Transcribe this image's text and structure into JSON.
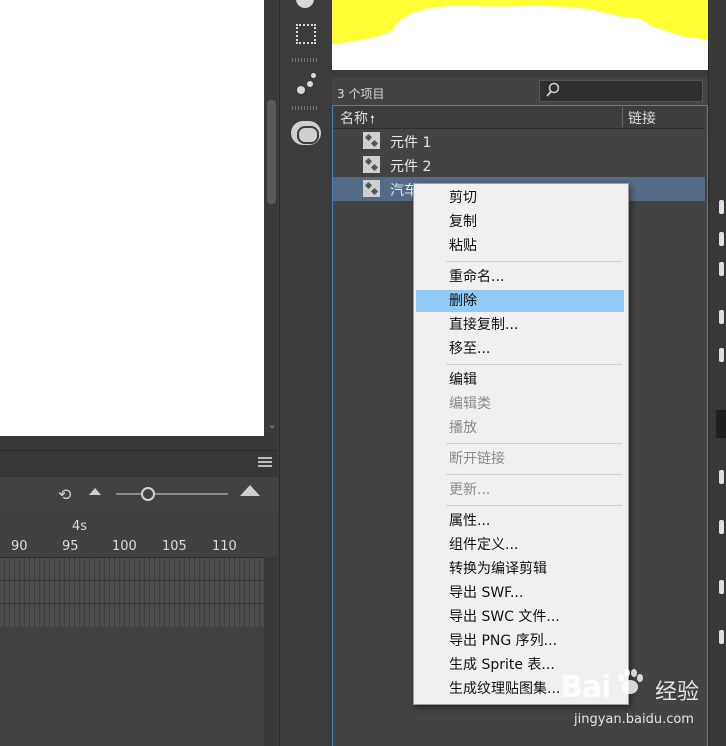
{
  "library": {
    "item_count": "3 个项目",
    "columns": {
      "name": "名称",
      "sort_arrow": "🠕",
      "linkage": "链接"
    },
    "items": [
      {
        "label": "元件 1"
      },
      {
        "label": "元件 2"
      },
      {
        "label": "汽车"
      }
    ]
  },
  "timeline": {
    "seconds_label": "4s",
    "ticks": [
      "90",
      "95",
      "100",
      "105",
      "110"
    ]
  },
  "context_menu": {
    "items": [
      {
        "label": "剪切",
        "enabled": true
      },
      {
        "label": "复制",
        "enabled": true
      },
      {
        "label": "粘贴",
        "enabled": true
      },
      {
        "label": "重命名...",
        "enabled": true
      },
      {
        "label": "删除",
        "enabled": true,
        "highlighted": true
      },
      {
        "label": "直接复制...",
        "enabled": true
      },
      {
        "label": "移至...",
        "enabled": true
      },
      {
        "label": "编辑",
        "enabled": true
      },
      {
        "label": "编辑类",
        "enabled": false
      },
      {
        "label": "播放",
        "enabled": false
      },
      {
        "label": "断开链接",
        "enabled": false
      },
      {
        "label": "更新...",
        "enabled": false
      },
      {
        "label": "属性...",
        "enabled": true
      },
      {
        "label": "组件定义...",
        "enabled": true
      },
      {
        "label": "转换为编译剪辑",
        "enabled": true
      },
      {
        "label": "导出 SWF...",
        "enabled": true
      },
      {
        "label": "导出 SWC 文件...",
        "enabled": true
      },
      {
        "label": "导出 PNG 序列...",
        "enabled": true
      },
      {
        "label": "生成 Sprite 表...",
        "enabled": true
      },
      {
        "label": "生成纹理贴图集...",
        "enabled": true
      }
    ]
  },
  "watermark": {
    "logo": "Bai",
    "text": "经验",
    "url": "jingyan.baidu.com"
  },
  "colors": {
    "highlight": "#91c9f7",
    "selected_row": "#546b86",
    "preview_fill": "#ffff33",
    "accent_border": "#4c82b9"
  },
  "icons": [
    "symbol-icon",
    "search-icon",
    "loop-icon",
    "mountain-small-icon",
    "mountain-large-icon",
    "panel-menu-icon",
    "transform-icon",
    "cc-libraries-icon"
  ]
}
